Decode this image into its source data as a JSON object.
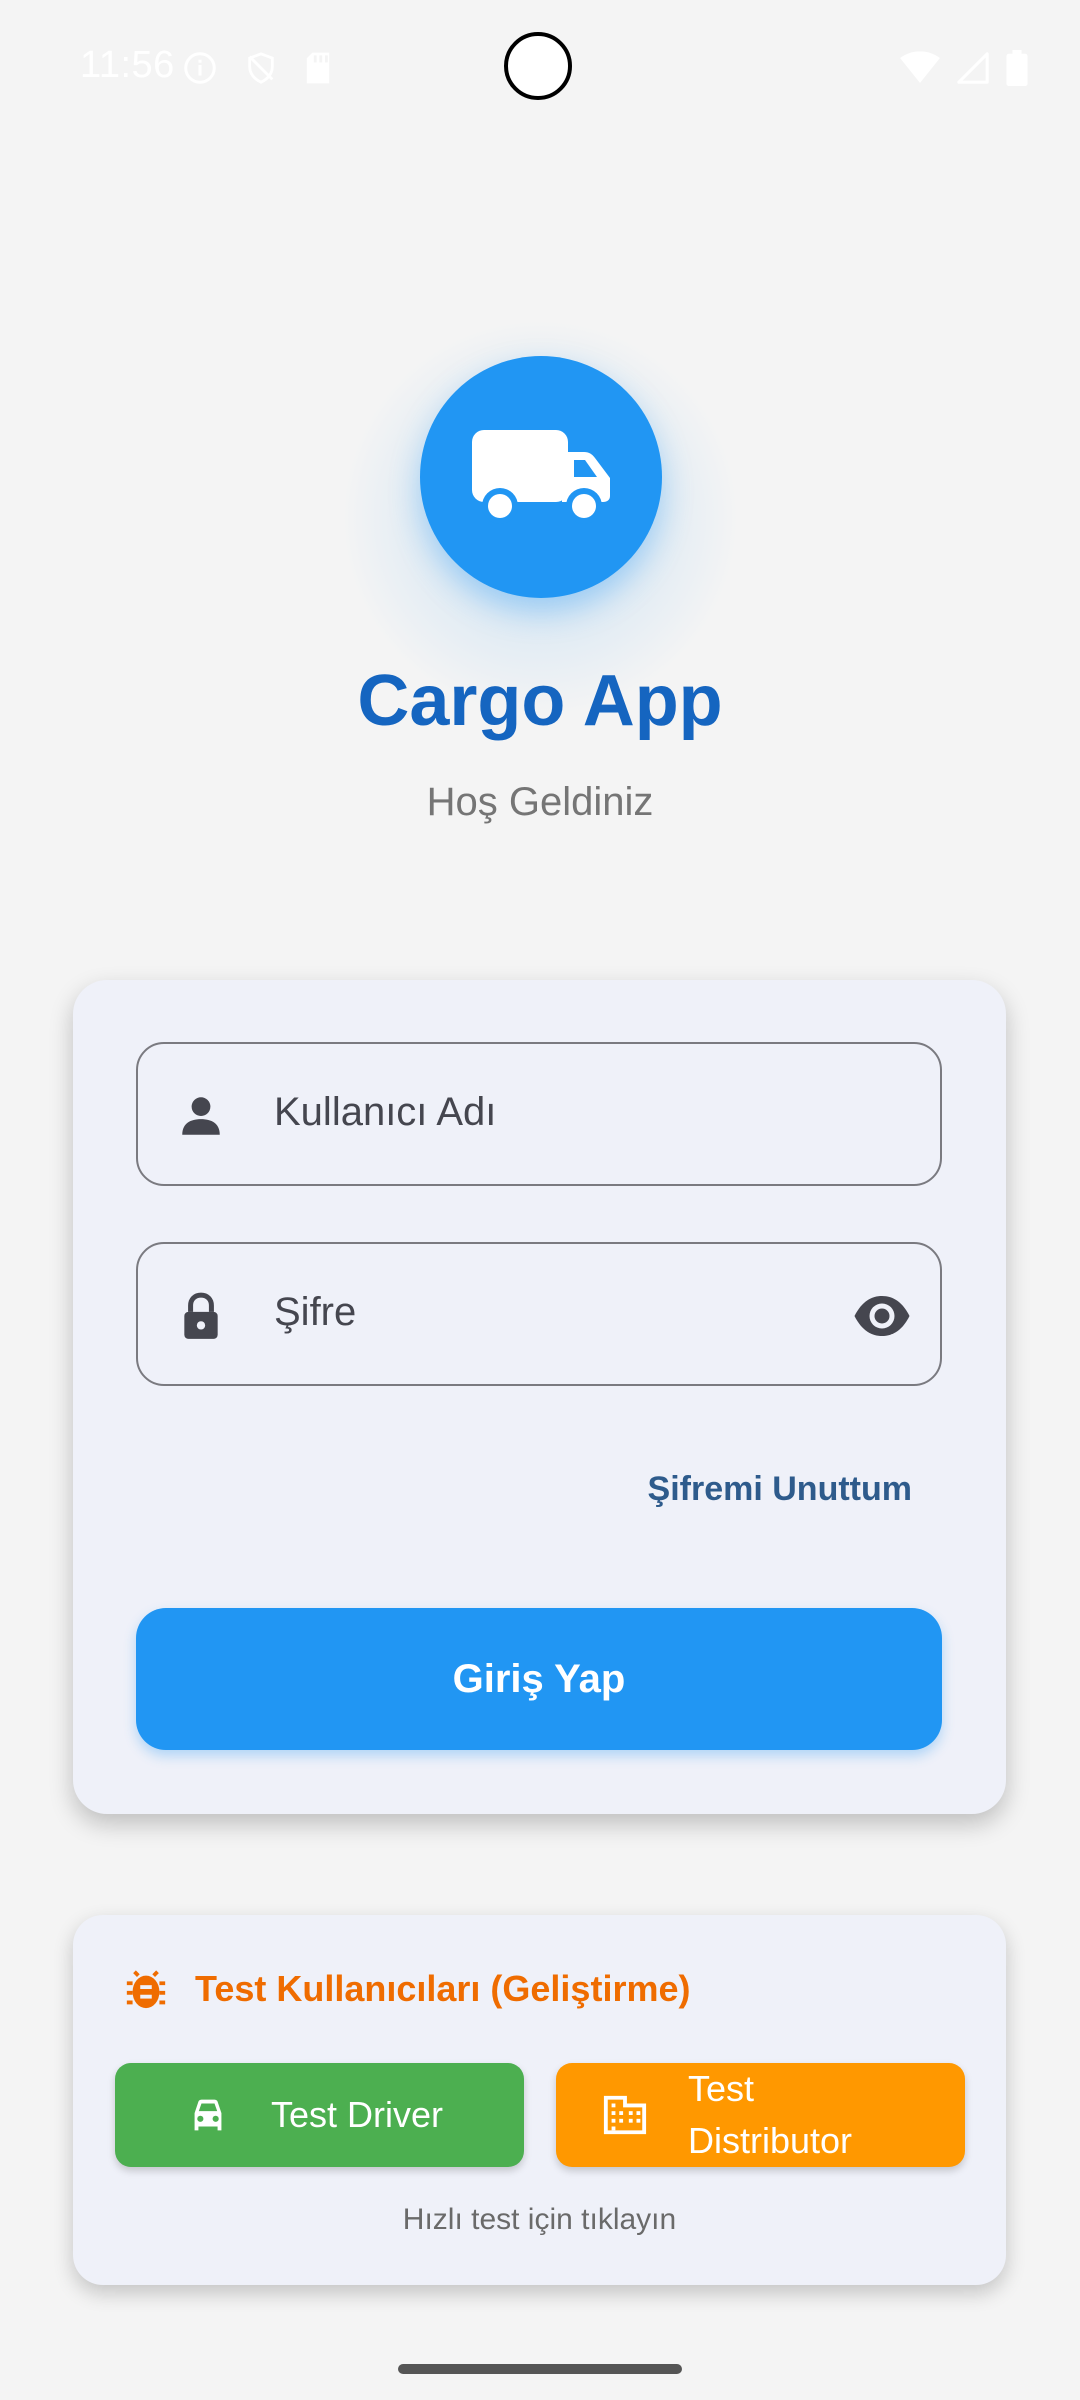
{
  "status_bar": {
    "time": "11:56",
    "left_icons": [
      "info-icon",
      "shield-icon",
      "sd-card-icon"
    ],
    "right_icons": [
      "wifi-icon",
      "signal-icon",
      "battery-icon"
    ]
  },
  "app": {
    "logo_icon": "truck-icon",
    "title": "Cargo App",
    "subtitle": "Hoş Geldiniz",
    "brand_color": "#2196F3",
    "title_color": "#1565C0"
  },
  "login_form": {
    "username": {
      "placeholder": "Kullanıcı Adı",
      "icon": "person-icon",
      "value": ""
    },
    "password": {
      "placeholder": "Şifre",
      "icon": "lock-icon",
      "toggle_icon": "eye-icon",
      "value": ""
    },
    "forgot_password": "Şifremi Unuttum",
    "submit_label": "Giriş Yap"
  },
  "test_users": {
    "icon": "bug-icon",
    "title": "Test Kullanıcıları (Geliştirme)",
    "driver_label": "Test Driver",
    "driver_icon": "car-icon",
    "driver_color": "#4CAF50",
    "distributor_label": "Test Distributor",
    "distributor_icon": "building-icon",
    "distributor_color": "#FF9800",
    "hint": "Hızlı test için tıklayın"
  }
}
